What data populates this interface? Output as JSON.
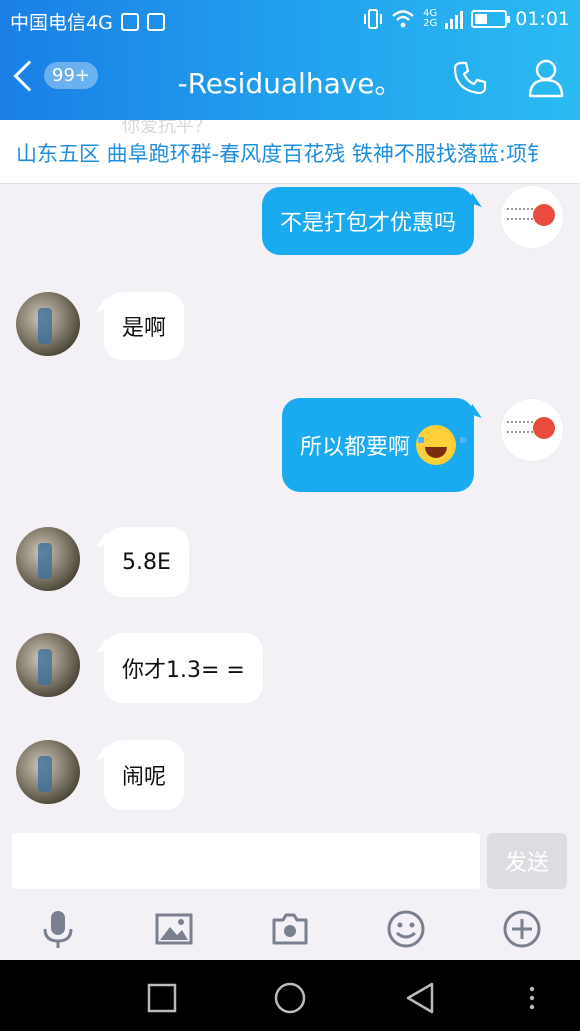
{
  "status_bar": {
    "carrier": "中国电信4G",
    "time": "01:01",
    "network_top": "4G",
    "network_bottom": "2G"
  },
  "header": {
    "back_badge": "99+",
    "title": "-Residualhave。"
  },
  "group_bar": {
    "ghost_text": "你爱抗平？",
    "text": "山东五区  曲阜跑环群-春风度百花残 铁神不服找落蓝:项钅"
  },
  "messages": [
    {
      "side": "self",
      "text": "不是打包才优惠吗"
    },
    {
      "side": "other",
      "text": "是啊"
    },
    {
      "side": "self",
      "text": "所以都要啊",
      "emoji": "laughing-crying-emoji"
    },
    {
      "side": "other",
      "text": "5.8E"
    },
    {
      "side": "other",
      "text": "你才1.3= ="
    },
    {
      "side": "other",
      "text": "闹呢"
    }
  ],
  "composer": {
    "placeholder": "",
    "send_label": "发送"
  },
  "colors": {
    "header_start": "#1a7fe6",
    "header_end": "#2bbbf2",
    "self_bubble": "#19aaf0",
    "link_blue": "#1c8fe0"
  }
}
